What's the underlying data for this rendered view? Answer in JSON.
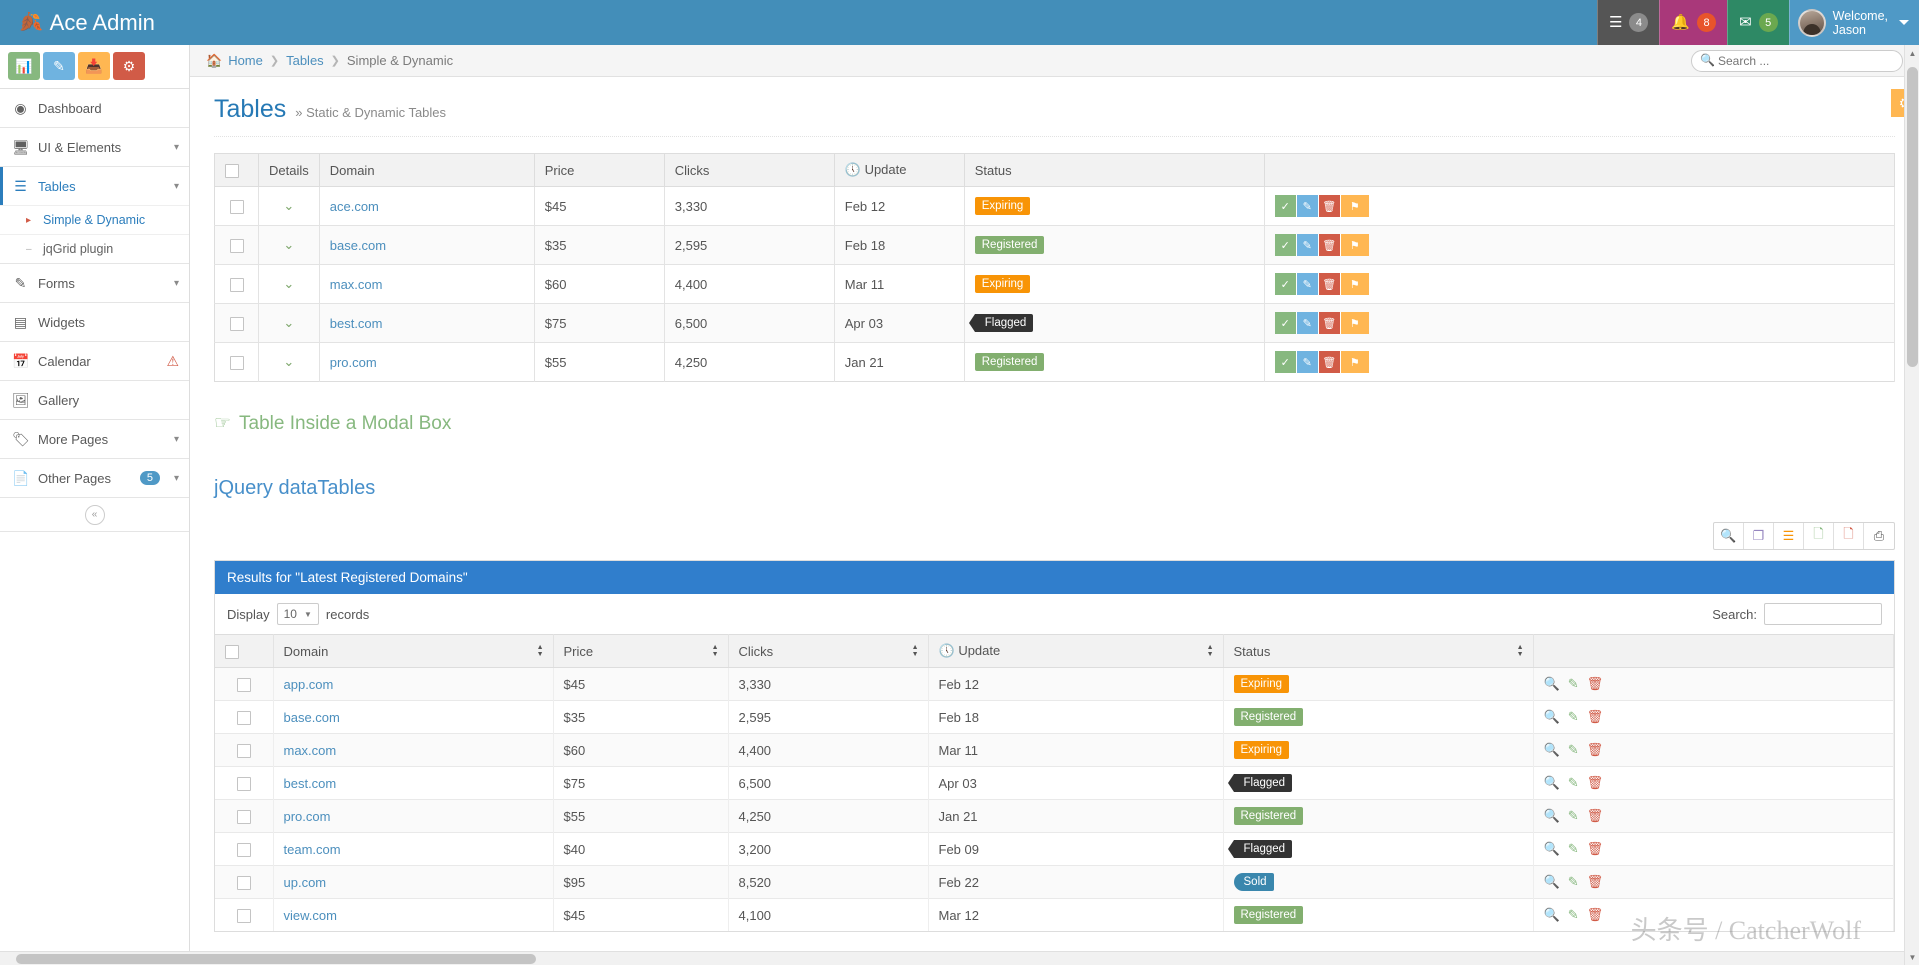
{
  "brand": {
    "name": "Ace Admin",
    "icon": "leaf-icon"
  },
  "navbar": {
    "tasks": {
      "icon": "tasks-icon",
      "count": "4"
    },
    "notifications": {
      "icon": "bell-icon",
      "count": "8"
    },
    "messages": {
      "icon": "envelope-icon",
      "count": "5"
    },
    "user": {
      "greeting": "Welcome,",
      "name": "Jason"
    }
  },
  "sidebar": {
    "shortcuts": [
      {
        "name": "chart-shortcut",
        "icon": "bar-chart-icon"
      },
      {
        "name": "edit-shortcut",
        "icon": "pencil-icon"
      },
      {
        "name": "inbox-shortcut",
        "icon": "inbox-icon"
      },
      {
        "name": "settings-shortcut",
        "icon": "cogs-icon"
      }
    ],
    "items": [
      {
        "label": "Dashboard",
        "icon": "dashboard-icon",
        "active": false,
        "caret": false
      },
      {
        "label": "UI & Elements",
        "icon": "desktop-icon",
        "active": false,
        "caret": true
      },
      {
        "label": "Tables",
        "icon": "list-icon",
        "active": true,
        "caret": true
      },
      {
        "label": "Forms",
        "icon": "edit-icon",
        "active": false,
        "caret": true
      },
      {
        "label": "Widgets",
        "icon": "widgets-icon",
        "active": false,
        "caret": false
      },
      {
        "label": "Calendar",
        "icon": "calendar-icon",
        "active": false,
        "caret": false,
        "warning": true
      },
      {
        "label": "Gallery",
        "icon": "picture-icon",
        "active": false,
        "caret": false
      },
      {
        "label": "More Pages",
        "icon": "tag-icon",
        "active": false,
        "caret": true
      },
      {
        "label": "Other Pages",
        "icon": "file-icon",
        "active": false,
        "caret": true,
        "badge": "5"
      }
    ],
    "submenu": [
      {
        "label": "Simple & Dynamic",
        "selected": true
      },
      {
        "label": "jqGrid plugin",
        "selected": false
      }
    ],
    "collapse_icon": "double-angle-left-icon"
  },
  "breadcrumb": {
    "home_icon": "home-icon",
    "items": [
      "Home",
      "Tables",
      "Simple & Dynamic"
    ],
    "search_placeholder": "Search ...",
    "search_value": "",
    "search_icon": "search-icon"
  },
  "page": {
    "title": "Tables",
    "subtitle": "» Static & Dynamic Tables",
    "settings_icon": "cog-icon"
  },
  "table1": {
    "columns": [
      "",
      "Details",
      "Domain",
      "Price",
      "Clicks",
      "Update",
      "Status",
      ""
    ],
    "update_icon": "clock-icon",
    "rows": [
      {
        "domain": "ace.com",
        "price": "$45",
        "clicks": "3,330",
        "update": "Feb 12",
        "status": "Expiring",
        "status_type": "warning"
      },
      {
        "domain": "base.com",
        "price": "$35",
        "clicks": "2,595",
        "update": "Feb 18",
        "status": "Registered",
        "status_type": "success"
      },
      {
        "domain": "max.com",
        "price": "$60",
        "clicks": "4,400",
        "update": "Mar 11",
        "status": "Expiring",
        "status_type": "warning"
      },
      {
        "domain": "best.com",
        "price": "$75",
        "clicks": "6,500",
        "update": "Apr 03",
        "status": "Flagged",
        "status_type": "inverse"
      },
      {
        "domain": "pro.com",
        "price": "$55",
        "clicks": "4,250",
        "update": "Jan 21",
        "status": "Registered",
        "status_type": "success"
      }
    ],
    "actions": [
      {
        "name": "approve-button",
        "icon": "check-icon",
        "cls": "ok"
      },
      {
        "name": "edit-button",
        "icon": "pencil-icon",
        "cls": "ed"
      },
      {
        "name": "delete-button",
        "icon": "trash-icon",
        "cls": "del"
      },
      {
        "name": "flag-button",
        "icon": "flag-icon",
        "cls": "flg"
      }
    ]
  },
  "modal_link": {
    "label": "Table Inside a Modal Box",
    "icon": "hand-pointer-icon"
  },
  "datatables": {
    "heading": "jQuery dataTables",
    "tools": [
      {
        "name": "search-tool",
        "icon": "search-icon"
      },
      {
        "name": "copy-tool",
        "icon": "copy-icon"
      },
      {
        "name": "csv-tool",
        "icon": "database-icon"
      },
      {
        "name": "excel-tool",
        "icon": "excel-icon"
      },
      {
        "name": "pdf-tool",
        "icon": "pdf-icon"
      },
      {
        "name": "print-tool",
        "icon": "print-icon"
      }
    ],
    "results_title": "Results for \"Latest Registered Domains\"",
    "display_prefix": "Display",
    "display_value": "10",
    "display_suffix": "records",
    "search_label": "Search:",
    "search_value": "",
    "columns": [
      "",
      "Domain",
      "Price",
      "Clicks",
      "Update",
      "Status",
      ""
    ],
    "update_icon": "clock-icon",
    "rows": [
      {
        "domain": "app.com",
        "price": "$45",
        "clicks": "3,330",
        "update": "Feb 12",
        "status": "Expiring",
        "status_type": "warning"
      },
      {
        "domain": "base.com",
        "price": "$35",
        "clicks": "2,595",
        "update": "Feb 18",
        "status": "Registered",
        "status_type": "success"
      },
      {
        "domain": "max.com",
        "price": "$60",
        "clicks": "4,400",
        "update": "Mar 11",
        "status": "Expiring",
        "status_type": "warning"
      },
      {
        "domain": "best.com",
        "price": "$75",
        "clicks": "6,500",
        "update": "Apr 03",
        "status": "Flagged",
        "status_type": "inverse"
      },
      {
        "domain": "pro.com",
        "price": "$55",
        "clicks": "4,250",
        "update": "Jan 21",
        "status": "Registered",
        "status_type": "success"
      },
      {
        "domain": "team.com",
        "price": "$40",
        "clicks": "3,200",
        "update": "Feb 09",
        "status": "Flagged",
        "status_type": "inverse"
      },
      {
        "domain": "up.com",
        "price": "$95",
        "clicks": "8,520",
        "update": "Feb 22",
        "status": "Sold",
        "status_type": "info"
      },
      {
        "domain": "view.com",
        "price": "$45",
        "clicks": "4,100",
        "update": "Mar 12",
        "status": "Registered",
        "status_type": "success"
      }
    ],
    "row_actions": [
      {
        "name": "view-row-button",
        "icon": "zoom-in-icon",
        "cls": "a-view"
      },
      {
        "name": "edit-row-button",
        "icon": "pencil-icon",
        "cls": "a-edit"
      },
      {
        "name": "delete-row-button",
        "icon": "trash-icon",
        "cls": "a-del"
      }
    ]
  },
  "watermark": {
    "text": "头条号 / CatcherWolf"
  },
  "colors": {
    "brand_blue": "#438EB9",
    "accent_blue": "#307ECC",
    "success": "#82AF6F",
    "warning": "#F89406",
    "danger": "#D15B47",
    "info": "#3A87AD",
    "inverse": "#333333"
  }
}
